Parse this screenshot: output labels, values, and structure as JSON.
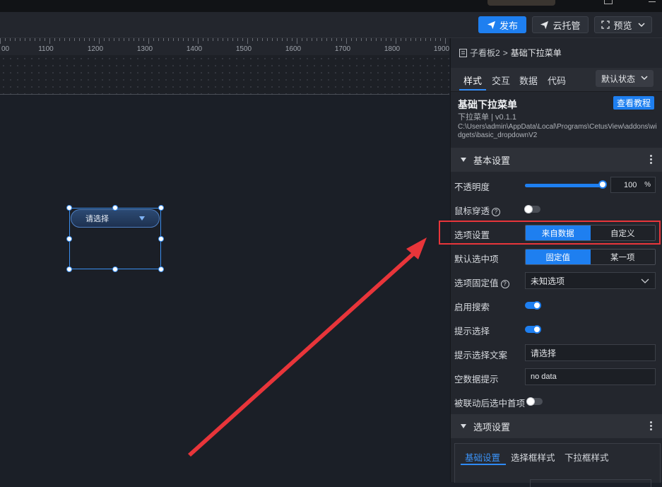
{
  "toolbar": {
    "publish_label": "发布",
    "cloud_label": "云托管",
    "preview_label": "预览"
  },
  "ruler": {
    "labels": [
      "00",
      "1100",
      "1200",
      "1300",
      "1400",
      "1500",
      "1600",
      "1700",
      "1800",
      "1900"
    ]
  },
  "canvas_widget": {
    "placeholder": "请选择"
  },
  "panel": {
    "breadcrumb_parent": "子看板2",
    "breadcrumb_sep": ">",
    "breadcrumb_current": "基础下拉菜单",
    "tabs": [
      "样式",
      "交互",
      "数据",
      "代码"
    ],
    "state_select": "默认状态",
    "widget_title": "基础下拉菜单",
    "tutorial_label": "查看教程",
    "widget_version": "下拉菜单 | v0.1.1",
    "widget_path": "C:\\Users\\admin\\AppData\\Local\\Programs\\CetusView\\addons\\widgets\\basic_dropdownV2",
    "section_basic": "基本设置",
    "opacity_label": "不透明度",
    "opacity_value": "100",
    "opacity_unit": "%",
    "opacity_level": 1.0,
    "mouse_passthrough_label": "鼠标穿透",
    "mouse_passthrough_on": false,
    "options_setting_label": "选项设置",
    "options_setting_choices": [
      "来自数据",
      "自定义"
    ],
    "options_setting_selected": "来自数据",
    "default_selected_label": "默认选中项",
    "default_selected_choices": [
      "固定值",
      "某一项"
    ],
    "default_selected_selected": "固定值",
    "fixed_value_label": "选项固定值",
    "fixed_value": "未知选项",
    "enable_search_label": "启用搜索",
    "enable_search_on": true,
    "prompt_select_label": "提示选择",
    "prompt_select_on": true,
    "prompt_text_label": "提示选择文案",
    "prompt_text_value": "请选择",
    "empty_data_label": "空数据提示",
    "empty_data_value": "no data",
    "linked_first_label": "被联动后选中首项",
    "linked_first_on": false,
    "section_options": "选项设置",
    "subtabs": [
      "基础设置",
      "选择框样式",
      "下拉框样式"
    ],
    "help_glyph": "?"
  },
  "colors": {
    "accent": "#1e7ff0",
    "highlight": "#e8353a"
  }
}
